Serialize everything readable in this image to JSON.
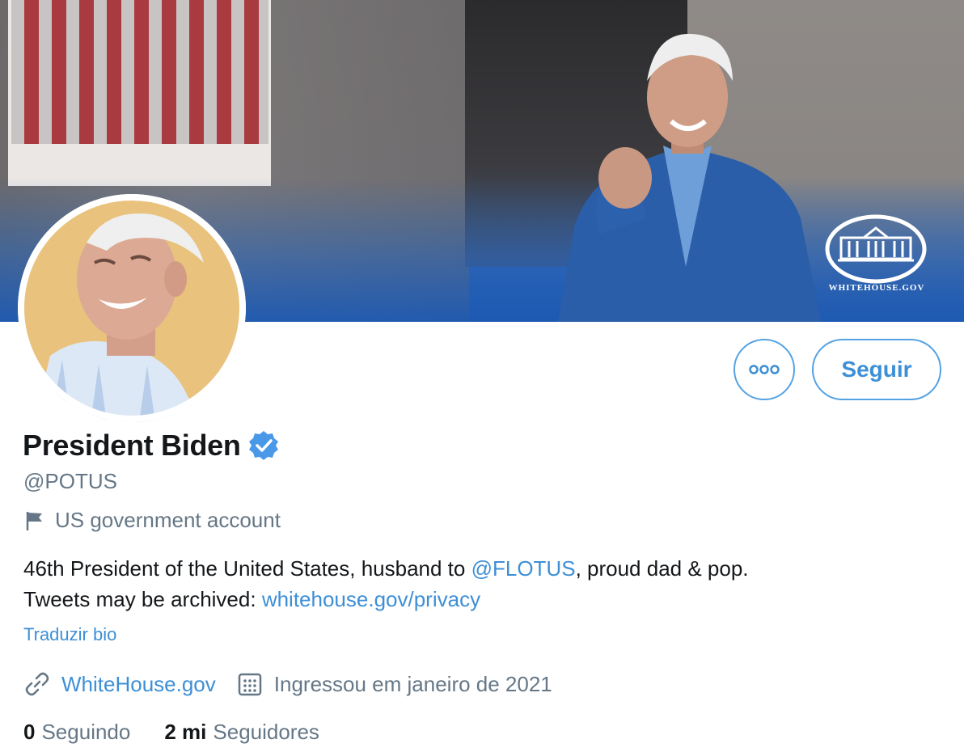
{
  "banner": {
    "watermark_text": "WHITEHOUSE.GOV"
  },
  "actions": {
    "more_icon": "more-dots-icon",
    "follow_label": "Seguir"
  },
  "profile": {
    "name": "President Biden",
    "verified_icon": "verified-badge-icon",
    "handle": "@POTUS",
    "label_icon": "flag-icon",
    "label": "US government account",
    "bio": {
      "text_1": "46th President of the United States, husband to ",
      "mention": "@FLOTUS",
      "text_2": ", proud dad & pop.",
      "text_3": "Tweets may be archived: ",
      "link": "whitehouse.gov/privacy"
    },
    "translate_label": "Traduzir bio",
    "website_icon": "link-icon",
    "website": "WhiteHouse.gov",
    "joined_icon": "calendar-icon",
    "joined": "Ingressou em janeiro de 2021",
    "following_count": "0",
    "following_label": "Seguindo",
    "followers_count": "2 mi",
    "followers_label": "Seguidores"
  },
  "colors": {
    "accent": "#3d8fd6",
    "text_primary": "#14171a",
    "text_secondary": "#657786",
    "verified": "#4a99e9"
  }
}
